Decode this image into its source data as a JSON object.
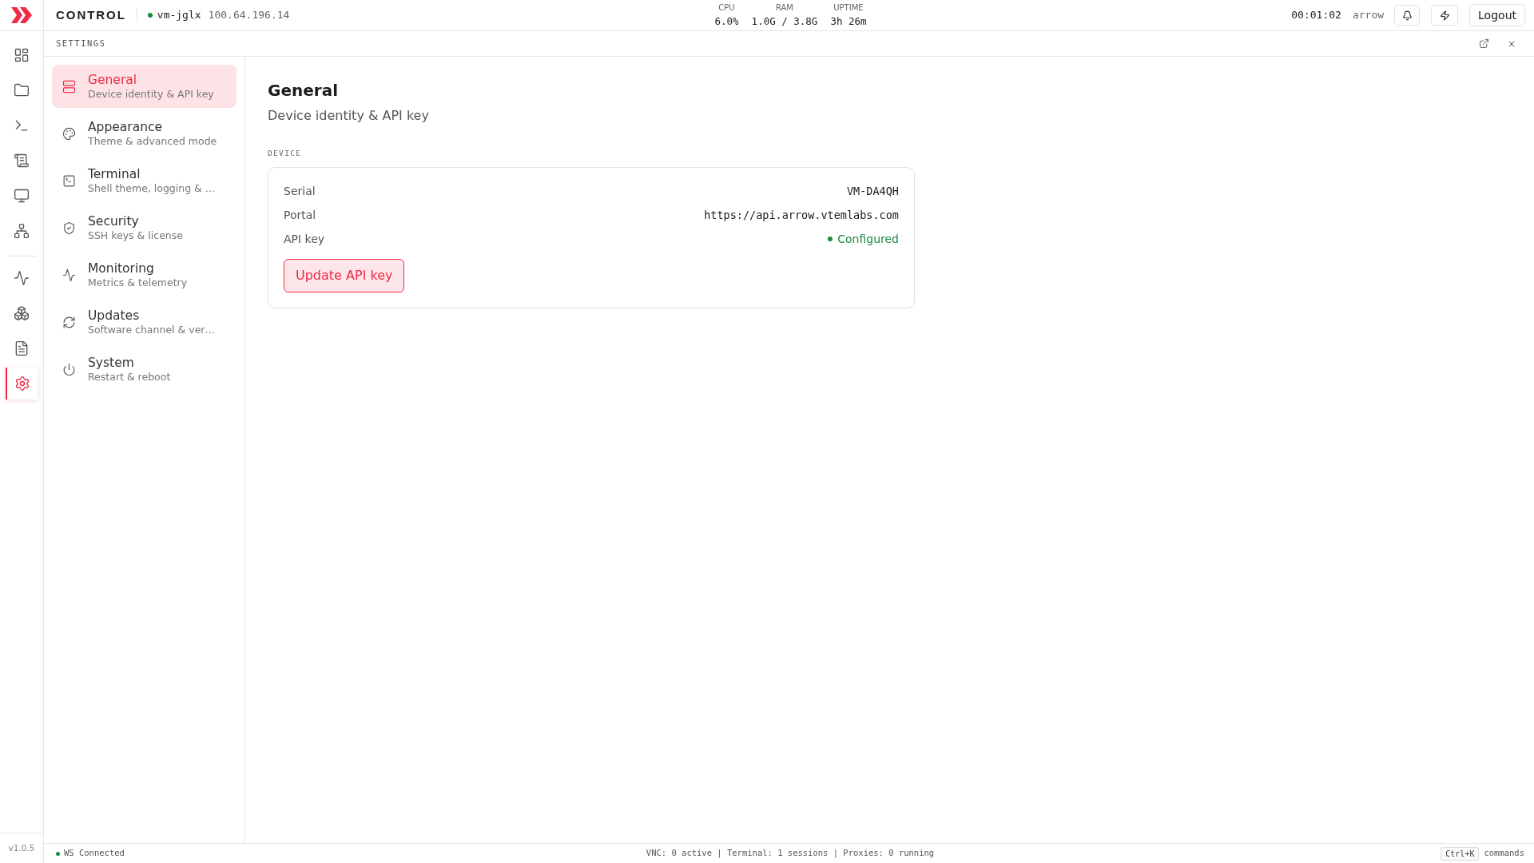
{
  "brand": {
    "title": "CONTROL"
  },
  "host": {
    "name": "vm-jglx",
    "ip": "100.64.196.14",
    "online": true
  },
  "stats": [
    {
      "label": "CPU",
      "value": "6.0%"
    },
    {
      "label": "RAM",
      "value": "1.0G / 3.8G"
    },
    {
      "label": "UPTIME",
      "value": "3h 26m"
    }
  ],
  "session": {
    "clock": "00:01:02",
    "user": "arrow",
    "logout": "Logout"
  },
  "rail": {
    "groups": [
      {
        "items": [
          {
            "selected": false
          },
          {
            "selected": false
          },
          {
            "selected": false
          },
          {
            "selected": false
          },
          {
            "selected": false
          },
          {
            "selected": false
          }
        ]
      },
      {
        "items": [
          {
            "selected": false
          },
          {
            "selected": false
          },
          {
            "selected": false
          },
          {
            "selected": true
          }
        ]
      }
    ],
    "version": "v1.0.5"
  },
  "panel": {
    "title": "SETTINGS"
  },
  "nav": [
    {
      "label": "General",
      "description": "Device identity & API key",
      "selected": true
    },
    {
      "label": "Appearance",
      "description": "Theme & advanced mode",
      "selected": false
    },
    {
      "label": "Terminal",
      "description": "Shell theme, logging & …",
      "selected": false
    },
    {
      "label": "Security",
      "description": "SSH keys & license",
      "selected": false
    },
    {
      "label": "Monitoring",
      "description": "Metrics & telemetry",
      "selected": false
    },
    {
      "label": "Updates",
      "description": "Software channel & ver…",
      "selected": false
    },
    {
      "label": "System",
      "description": "Restart & reboot",
      "selected": false
    }
  ],
  "page": {
    "title": "General",
    "subtitle": "Device identity & API key",
    "section": "DEVICE",
    "fields": [
      {
        "kind": "text",
        "label": "Serial",
        "value": "VM-DA4QH"
      },
      {
        "kind": "text",
        "label": "Portal",
        "value": "https://api.arrow.vtemlabs.com"
      },
      {
        "kind": "status",
        "label": "API key",
        "value": "Configured",
        "ok": true
      }
    ],
    "button": "Update API key"
  },
  "status_bar": {
    "connection": {
      "label": "WS Connected",
      "online": true
    },
    "summary": "VNC: 0 active | Terminal: 1 sessions | Proxies: 0 running",
    "shortcut": {
      "key": "Ctrl+K",
      "label": "commands"
    }
  }
}
